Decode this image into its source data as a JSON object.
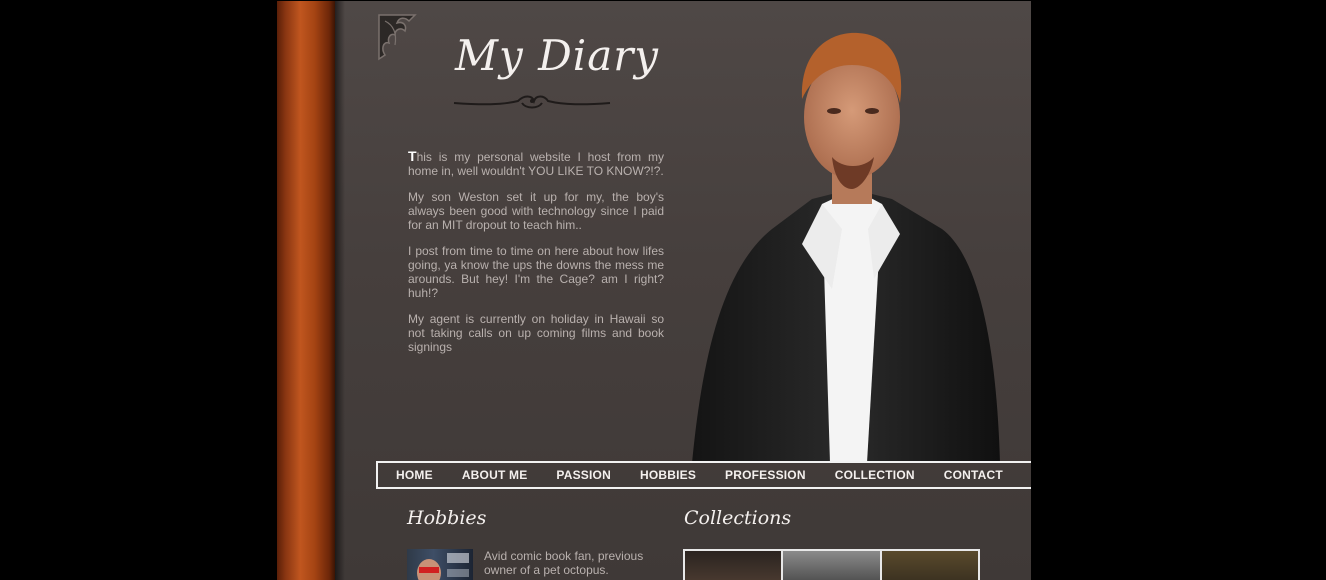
{
  "site": {
    "title": "My Diary"
  },
  "intro": {
    "dropcap": "T",
    "p1_rest": "his is my personal website I host from my home in, well wouldn't YOU LIKE TO KNOW?!?.",
    "p2": "My son Weston set it up for my, the boy's always been good with technology since I paid for an MIT dropout to teach him..",
    "p3": "I post from time to time on here about how lifes going, ya know the ups the downs the mess me arounds. But hey! I'm the Cage? am I right? huh!?",
    "p4": "My agent is currently on holiday in Hawaii so not taking calls on up coming films and book signings"
  },
  "nav": {
    "home": "HOME",
    "about": "ABOUT ME",
    "passion": "PASSION",
    "hobbies": "HOBBIES",
    "profession": "PROFESSION",
    "collection": "COLLECTION",
    "contact": "CONTACT"
  },
  "hobbies": {
    "heading": "Hobbies",
    "text": "Avid comic book fan, previous owner of a pet octopus."
  },
  "collections": {
    "heading": "Collections"
  },
  "colors": {
    "background": "#000000",
    "page": "#4a4341",
    "spine": "#a54413",
    "nav_text": "#f4f0ee",
    "body_text": "#b9b1ae"
  }
}
